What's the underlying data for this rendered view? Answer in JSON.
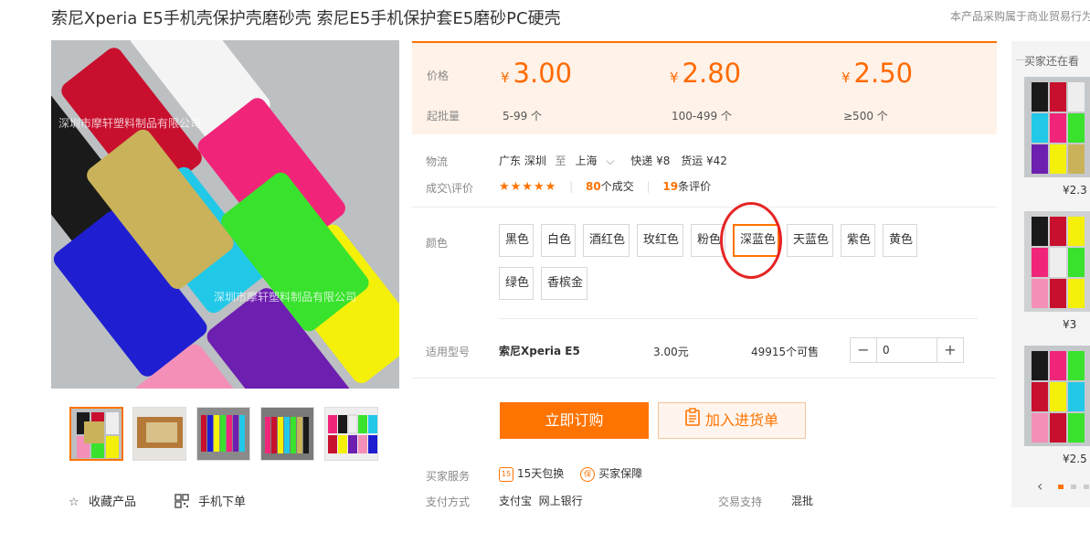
{
  "product": {
    "title": "索尼Xperia E5手机壳保护壳磨砂壳 索尼E5手机保护套E5磨砂PC硬壳",
    "notice": "本产品采购属于商业贸易行为",
    "watermark": "深圳市摩轩塑料制品有限公司"
  },
  "gallery": {
    "favorite_label": "收藏产品",
    "mobile_label": "手机下单",
    "thumb_count": 5
  },
  "pricing": {
    "price_label": "价格",
    "moq_label": "起批量",
    "currency": "¥",
    "tiers": [
      {
        "price": "3.00",
        "range": "5-99 个"
      },
      {
        "price": "2.80",
        "range": "100-499 个"
      },
      {
        "price": "2.50",
        "range": "≥500 个"
      }
    ]
  },
  "logistics": {
    "label": "物流",
    "from": "广东 深圳",
    "to_word": "至",
    "to": "上海",
    "express": "快递 ¥8",
    "freight": "货运 ¥42"
  },
  "deals": {
    "label": "成交\\评价",
    "stars": "★★★★★",
    "deal_count": "80",
    "deal_suffix": "个成交",
    "review_count": "19",
    "review_suffix": "条评价"
  },
  "colors": {
    "label": "颜色",
    "options": [
      "黑色",
      "白色",
      "酒红色",
      "玫红色",
      "粉色",
      "深蓝色",
      "天蓝色",
      "紫色",
      "黄色",
      "绿色",
      "香槟金"
    ],
    "selected": "深蓝色"
  },
  "model": {
    "label": "适用型号",
    "name": "索尼Xperia E5",
    "price": "3.00元",
    "stock": "49915个可售",
    "quantity": "0"
  },
  "actions": {
    "buy_label": "立即订购",
    "cart_label": "加入进货单"
  },
  "service": {
    "label": "买家服务",
    "item1": "15天包换",
    "item1_icon_text": "15",
    "item2": "买家保障",
    "item2_icon_text": "保"
  },
  "payment": {
    "label": "支付方式",
    "methods": "支付宝  网上银行",
    "trade_label": "交易支持",
    "trade_value": "混批"
  },
  "sidebar": {
    "title": "买家还在看",
    "items": [
      {
        "price": "¥2.3"
      },
      {
        "price": "¥3"
      },
      {
        "price": "¥2.5"
      }
    ]
  },
  "colors_palette": {
    "accent": "#ff7300",
    "price": "#ff6a00",
    "highlight_circle": "#e62424"
  }
}
